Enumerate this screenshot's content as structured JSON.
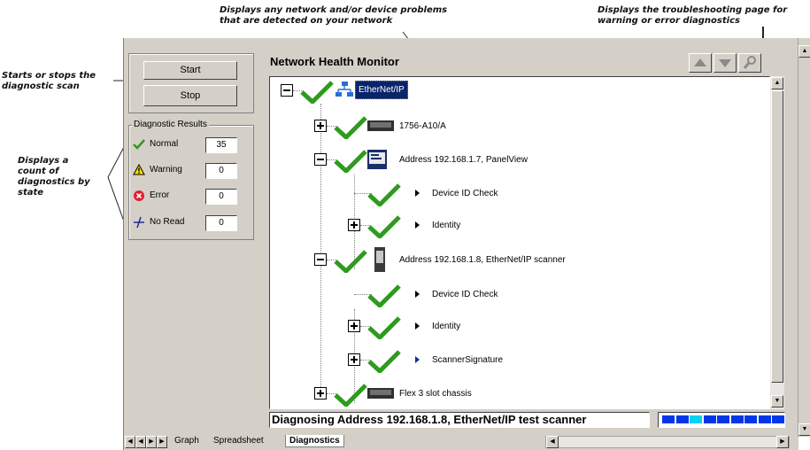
{
  "callouts": {
    "problems": "Displays any network and/or device problems that are detected on your network",
    "troubleshoot": "Displays the troubleshooting page for warning or error diagnostics",
    "scan": "Starts or stops the diagnostic scan",
    "count": "Displays a count of diagnostics by state"
  },
  "controls": {
    "start": "Start",
    "stop": "Stop"
  },
  "diag": {
    "title": "Diagnostic Results",
    "rows": [
      {
        "label": "Normal",
        "value": "35",
        "icon": "check-icon"
      },
      {
        "label": "Warning",
        "value": "0",
        "icon": "warning-icon"
      },
      {
        "label": "Error",
        "value": "0",
        "icon": "error-icon"
      },
      {
        "label": "No Read",
        "value": "0",
        "icon": "no-read-icon"
      }
    ]
  },
  "monitor": {
    "title": "Network Health Monitor"
  },
  "tree": {
    "root": "EtherNet/IP",
    "n1": "1756-A10/A",
    "n2": "Address 192.168.1.7, PanelView",
    "n2a": "Device ID Check",
    "n2b": "Identity",
    "n3": "Address 192.168.1.8, EtherNet/IP scanner",
    "n3a": "Device ID Check",
    "n3b": "Identity",
    "n3c": "ScannerSignature",
    "n4": "Flex 3 slot chassis"
  },
  "status": {
    "text": "Diagnosing Address 192.168.1.8, EtherNet/IP test scanner"
  },
  "progress": {
    "segments": 9,
    "highlight": 2
  },
  "tabs": [
    "Graph",
    "Spreadsheet",
    "Diagnostics"
  ],
  "colors": {
    "check": "#2e9b1e",
    "progress": "#0037e8",
    "selected": "#0a246a"
  }
}
